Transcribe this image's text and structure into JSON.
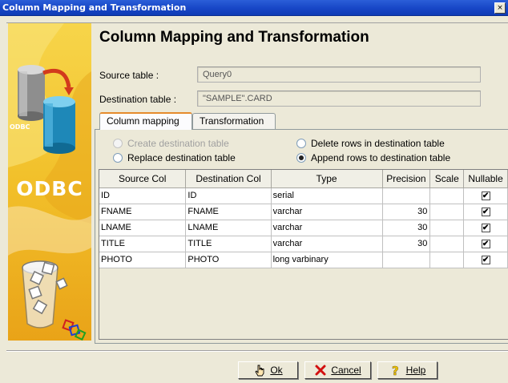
{
  "window": {
    "title": "Column Mapping and Transformation",
    "close_glyph": "×"
  },
  "banner": {
    "logo_small": "ODBC",
    "logo_big": "ODBC"
  },
  "heading": "Column Mapping and Transformation",
  "source": {
    "label": "Source table :",
    "value": "Query0"
  },
  "destination": {
    "label": "Destination table :",
    "value": "\"SAMPLE\".CARD"
  },
  "tabs": [
    {
      "label": "Column mapping",
      "active": true
    },
    {
      "label": "Transformation",
      "active": false
    }
  ],
  "options": {
    "create": {
      "label": "Create destination table",
      "checked": false,
      "enabled": false
    },
    "replace": {
      "label": "Replace destination table",
      "checked": false,
      "enabled": true
    },
    "delete": {
      "label": "Delete rows in destination table",
      "checked": false,
      "enabled": true
    },
    "append": {
      "label": "Append rows to destination table",
      "checked": true,
      "enabled": true
    }
  },
  "grid": {
    "columns": [
      "Source Col",
      "Destination Col",
      "Type",
      "Precision",
      "Scale",
      "Nullable"
    ],
    "rows": [
      {
        "source": "ID",
        "dest": "ID",
        "type": "serial",
        "precision": "",
        "scale": "",
        "nullable": true
      },
      {
        "source": "FNAME",
        "dest": "FNAME",
        "type": "varchar",
        "precision": "30",
        "scale": "",
        "nullable": true
      },
      {
        "source": "LNAME",
        "dest": "LNAME",
        "type": "varchar",
        "precision": "30",
        "scale": "",
        "nullable": true
      },
      {
        "source": "TITLE",
        "dest": "TITLE",
        "type": "varchar",
        "precision": "30",
        "scale": "",
        "nullable": true
      },
      {
        "source": "PHOTO",
        "dest": "PHOTO",
        "type": "long varbinary",
        "precision": "",
        "scale": "",
        "nullable": true
      }
    ],
    "check_glyph": "✔"
  },
  "buttons": {
    "ok": "Ok",
    "cancel": "Cancel",
    "help": "Help"
  },
  "colors": {
    "titlebar": "#1746c6",
    "banner": "#f2c02a",
    "tab_accent": "#e68b2c"
  },
  "icons": {
    "ok": "hand-pointer-icon",
    "cancel": "red-x-icon",
    "help": "question-mark-icon"
  }
}
